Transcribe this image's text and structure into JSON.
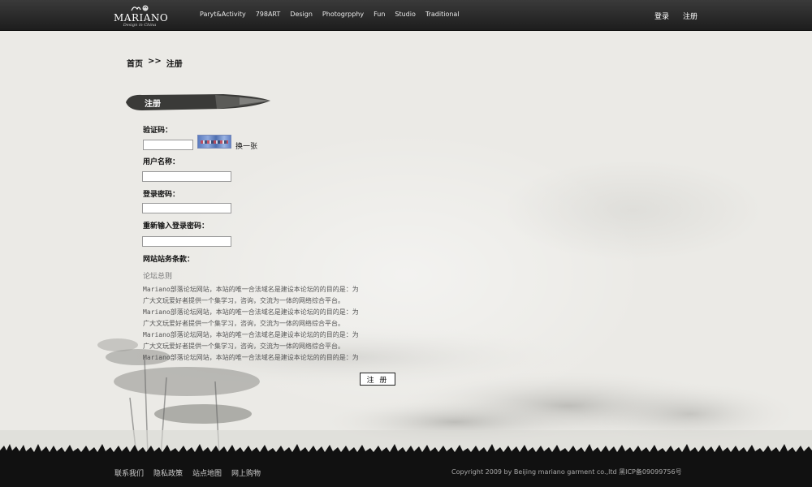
{
  "header": {
    "logo_text": "MARIANO",
    "logo_sub": "Design in China",
    "nav": [
      "Paryt&Activity",
      "798ART",
      "Design",
      "Photogrpphy",
      "Fun",
      "Studio",
      "Traditional"
    ],
    "login": "登录",
    "register": "注册"
  },
  "breadcrumb": {
    "home": "首页",
    "sep": ">>",
    "current": "注册"
  },
  "section_title": "注册",
  "form": {
    "captcha_label": "验证码：",
    "captcha_refresh": "换一张",
    "username_label": "用户名称：",
    "password_label": "登录密码：",
    "password_confirm_label": "重新输入登录密码：",
    "terms_label": "网站站务条款：",
    "terms_subtitle": "论坛总则",
    "terms_lines": [
      "Mariano部落论坛网站，本站的唯一合法域名是建设本论坛的的目的是：为",
      "广大文玩爱好者提供一个集学习，咨询，交流为一体的网络综合平台。",
      "Mariano部落论坛网站，本站的唯一合法域名是建设本论坛的的目的是：为",
      "广大文玩爱好者提供一个集学习，咨询，交流为一体的网络综合平台。",
      "Mariano部落论坛网站，本站的唯一合法域名是建设本论坛的的目的是：为",
      "广大文玩爱好者提供一个集学习，咨询，交流为一体的网络综合平台。",
      "Mariano部落论坛网站，本站的唯一合法域名是建设本论坛的的目的是：为"
    ],
    "submit": "注 册"
  },
  "footer": {
    "links": [
      "联系我们",
      "隐私政策",
      "站点地图",
      "网上购物"
    ],
    "copyright": "Copyright 2009 by Beijing mariano garment co.,ltd 黑ICP备09099756号"
  }
}
